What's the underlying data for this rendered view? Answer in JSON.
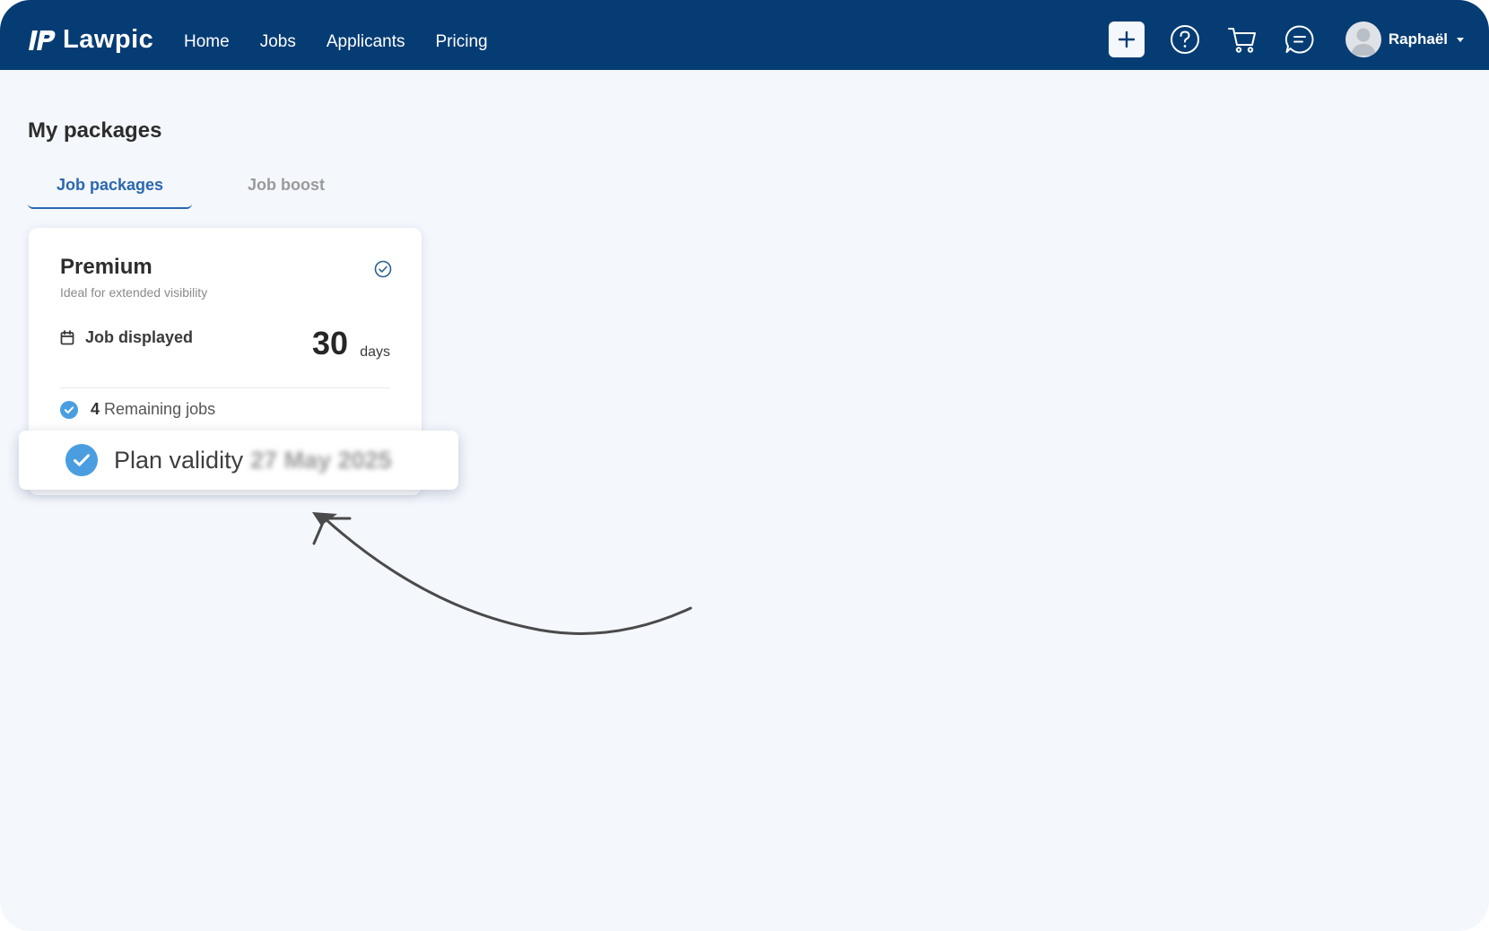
{
  "header": {
    "brand": "Lawpic",
    "nav": [
      {
        "label": "Home"
      },
      {
        "label": "Jobs"
      },
      {
        "label": "Applicants"
      },
      {
        "label": "Pricing"
      }
    ],
    "icons": [
      "plus-icon",
      "help-icon",
      "cart-icon",
      "chat-icon"
    ],
    "user_name": "Raphaël"
  },
  "page": {
    "title": "My packages",
    "tabs": [
      {
        "label": "Job packages",
        "active": true
      },
      {
        "label": "Job boost",
        "active": false
      }
    ]
  },
  "package_card": {
    "title": "Premium",
    "subtitle": "Ideal for extended visibility",
    "job_displayed_label": "Job displayed",
    "days_value": "30",
    "days_unit": "days",
    "remaining_count": "4",
    "remaining_label": "Remaining jobs"
  },
  "callout": {
    "label": "Plan validity",
    "date": "27 May 2025"
  },
  "colors": {
    "header_bg": "#063c74",
    "accent": "#2a68b0",
    "check_blue": "#4a9ee0",
    "page_bg": "#f4f7fc"
  }
}
